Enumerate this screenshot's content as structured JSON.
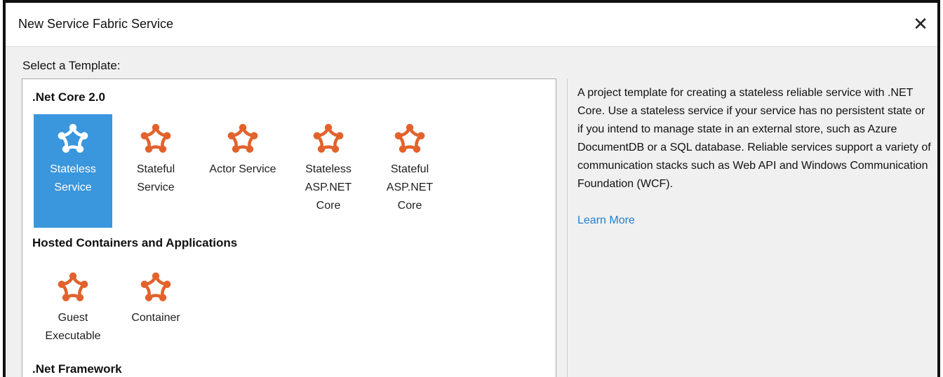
{
  "window": {
    "title": "New Service Fabric Service",
    "close_glyph": "✕"
  },
  "select_label": "Select a Template:",
  "groups": [
    {
      "header": ".Net Core 2.0",
      "templates": [
        {
          "label": "Stateless\nService",
          "selected": true
        },
        {
          "label": "Stateful\nService",
          "selected": false
        },
        {
          "label": "Actor Service",
          "selected": false
        },
        {
          "label": "Stateless\nASP.NET\nCore",
          "selected": false
        },
        {
          "label": "Stateful\nASP.NET\nCore",
          "selected": false
        }
      ]
    },
    {
      "header": "Hosted Containers and Applications",
      "templates": [
        {
          "label": "Guest\nExecutable",
          "selected": false
        },
        {
          "label": "Container",
          "selected": false
        }
      ]
    },
    {
      "header": ".Net Framework",
      "templates": []
    }
  ],
  "description": "A project template for creating a stateless reliable service with .NET Core. Use a stateless service if your service has no persistent state or if you intend to manage state in an external store, such as Azure DocumentDB or a SQL database. Reliable services support a variety of communication stacks such as Web API and Windows Communication Foundation (WCF).",
  "learn_more": "Learn More",
  "colors": {
    "icon": "#e2622c",
    "selected": "#3a96dd",
    "link": "#1f7fd0"
  }
}
